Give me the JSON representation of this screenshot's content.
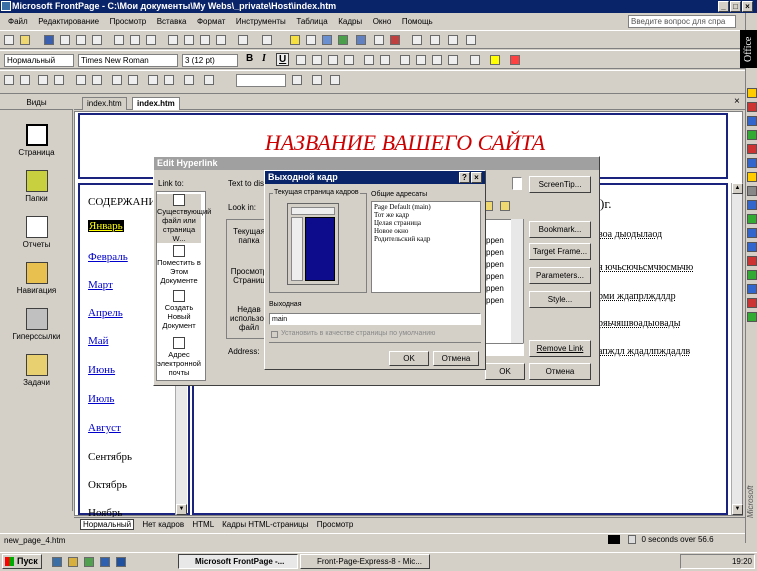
{
  "window": {
    "title": "Microsoft FrontPage - C:\\Мои документы\\My Webs\\_private\\Host\\index.htm",
    "minimize": "_",
    "maximize": "□",
    "close": "×"
  },
  "menu": [
    "Файл",
    "Редактирование",
    "Просмотр",
    "Вставка",
    "Формат",
    "Инструменты",
    "Таблица",
    "Кадры",
    "Окно",
    "Помощь"
  ],
  "ask_placeholder": "Введите вопрос для спра",
  "format": {
    "style": "Нормальный",
    "font": "Times New Roman",
    "size": "3 (12 pt)",
    "bold": "B",
    "italic": "I",
    "underline": "U"
  },
  "office_label": "Office",
  "office_bottom_label": "Microsoft",
  "views": {
    "header": "Виды",
    "items": [
      {
        "label": "Страница",
        "icon": "page-view-icon"
      },
      {
        "label": "Папки",
        "icon": "folders-view-icon"
      },
      {
        "label": "Отчеты",
        "icon": "reports-view-icon"
      },
      {
        "label": "Навигация",
        "icon": "navigation-view-icon"
      },
      {
        "label": "Гиперссылки",
        "icon": "hyperlinks-view-icon"
      },
      {
        "label": "Задачи",
        "icon": "tasks-view-icon"
      }
    ]
  },
  "tabs": [
    "index.htm",
    "index.htm"
  ],
  "page": {
    "site_title": "НАЗВАНИЕ ВАШЕГО САЙТА",
    "toc": "СОДЕРЖАНИЕ",
    "months": [
      "Январь",
      "Февраль",
      "Март",
      "Апрель",
      "Май",
      "Июнь",
      "Июль",
      "Август",
      "Сентябрь",
      "Октябрь",
      "Ноябрь"
    ],
    "right_year": ")г.",
    "right_lines": [
      "воа дыодылаод",
      "я ючьсючьсмчюсмьчю",
      "рми ждапрлждлдр",
      "ряьчяшвоадыовады",
      "апждл ждадлпждадлв"
    ]
  },
  "view_tabs": {
    "normal": "Нормальный",
    "no_frames": "Нет кадров",
    "html": "HTML",
    "frames_html": "Кадры HTML-страницы",
    "preview": "Просмотр"
  },
  "status": {
    "file": "new_page_4.htm",
    "timing": "0 seconds over 56.6"
  },
  "taskbar": {
    "start": "Пуск",
    "items": [
      "Microsoft FrontPage -...",
      "Front-Page-Express-8 - Mic..."
    ],
    "clock": "19:20"
  },
  "edit_hyperlink": {
    "title": "Edit Hyperlink",
    "link_to": "Link to:",
    "text_display": "Text to disp",
    "look_in": "Look in:",
    "link_options": [
      "Существующий файл или страница W...",
      "Поместить в Этом Документе",
      "Создать Новый Документ",
      "Адрес электронной почты"
    ],
    "current_folder": "Текущая папка",
    "browsed": "Просмотр Страниц",
    "recent": "Недав использов файл",
    "address": "Address:",
    "screen_tip": "ScreenTip...",
    "bookmark": "Bookmark...",
    "target_frame": "Target Frame...",
    "parameters": "Parameters...",
    "style": "Style...",
    "remove_link": "Remove Link",
    "ok": "OK",
    "cancel": "Отмена",
    "file_list": [
      "ppen",
      "ppen",
      "ppen",
      "ppen",
      "ppen",
      "ppen"
    ],
    "help": "?",
    "close": "×"
  },
  "target_frame": {
    "title": "Выходной кадр",
    "current_label": "Текущая страница кадров",
    "common_label": "Общие адресаты",
    "common_targets": [
      "Page Default (main)",
      "Тот же кадр",
      "Целая страница",
      "Новое окно",
      "Родительский кадр"
    ],
    "output_label": "Выходная",
    "output_value": "main",
    "checkbox_label": "Установить в качестве страницы по умолчанию",
    "ok": "OK",
    "cancel": "Отмена",
    "help": "?",
    "close": "×"
  }
}
